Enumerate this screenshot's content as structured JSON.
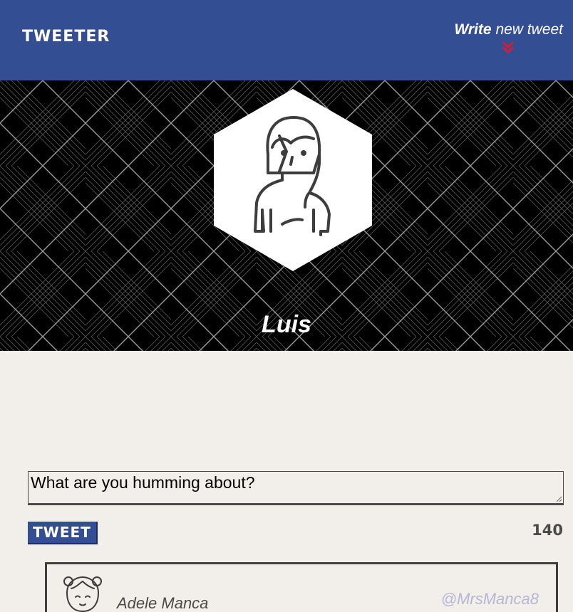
{
  "nav": {
    "brand": "TWEETER",
    "compose_bold": "Write",
    "compose_rest": " new tweet",
    "compose_icon": "double-chevron-down-icon",
    "accent_color": "#e0192b"
  },
  "profile": {
    "name": "Luis",
    "avatar_icon": "female-avatar-icon"
  },
  "composer": {
    "placeholder": "What are you humming about?",
    "value": "",
    "button_label": "TWEET",
    "char_counter": "140"
  },
  "tweets": [
    {
      "name": "Adele Manca",
      "handle": "@MrsManca8",
      "avatar_icon": "female-avatar-icon"
    }
  ],
  "colors": {
    "nav_bg": "#344e94",
    "page_bg": "#f2efea",
    "header_bg": "#000000",
    "handle": "#b6b6d6"
  }
}
